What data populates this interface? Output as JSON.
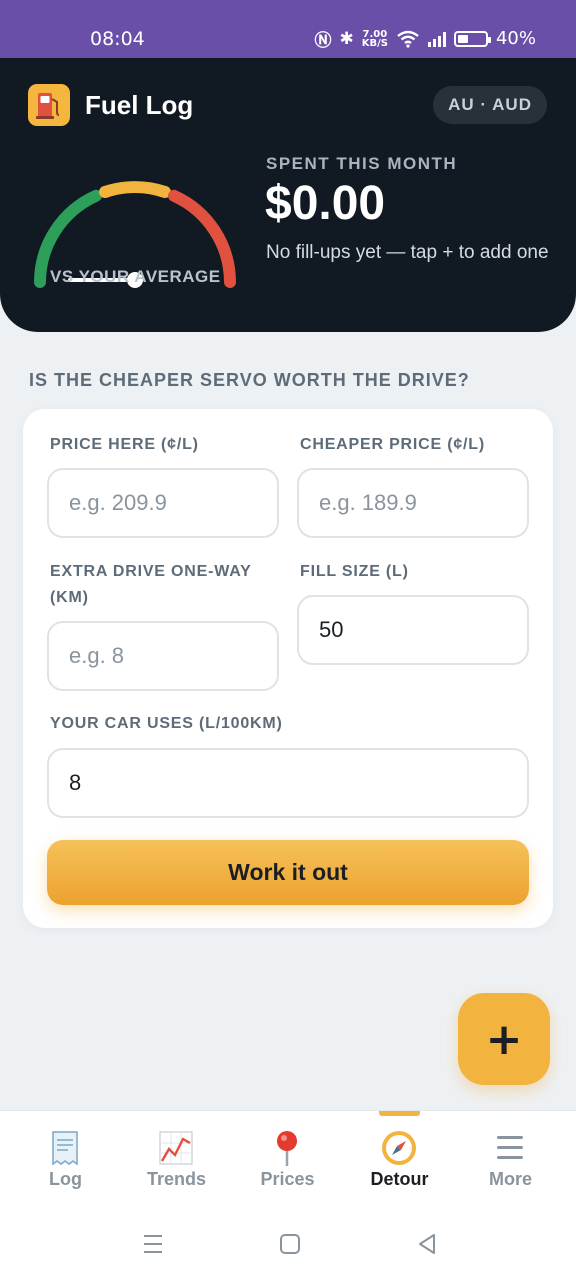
{
  "status_bar": {
    "time": "08:04",
    "net_speed_value": "7.00",
    "net_speed_unit": "KB/S",
    "battery": "40%",
    "battery_level": 0.4
  },
  "header": {
    "app_title": "Fuel Log",
    "region": "AU · AUD",
    "gauge_label": "VS YOUR AVERAGE",
    "spent_label": "SPENT THIS MONTH",
    "spent_value": "$0.00",
    "spent_note": "No fill-ups yet — tap + to add one"
  },
  "calculator": {
    "section_title": "IS THE CHEAPER SERVO WORTH THE DRIVE?",
    "fields": {
      "price_here": {
        "label": "PRICE HERE (¢/L)",
        "value": "",
        "placeholder": "e.g. 209.9"
      },
      "cheaper_price": {
        "label": "CHEAPER PRICE (¢/L)",
        "value": "",
        "placeholder": "e.g. 189.9"
      },
      "extra_drive": {
        "label": "EXTRA DRIVE ONE-WAY (KM)",
        "value": "",
        "placeholder": "e.g. 8"
      },
      "fill_size": {
        "label": "FILL SIZE (L)",
        "value": "50",
        "placeholder": ""
      },
      "car_uses": {
        "label": "YOUR CAR USES (L/100KM)",
        "value": "8",
        "placeholder": ""
      }
    },
    "button_label": "Work it out"
  },
  "fab": {
    "label": "+"
  },
  "bottom_nav": {
    "items": [
      {
        "label": "Log",
        "icon": "receipt-icon"
      },
      {
        "label": "Trends",
        "icon": "chart-icon"
      },
      {
        "label": "Prices",
        "icon": "pin-icon"
      },
      {
        "label": "Detour",
        "icon": "compass-icon",
        "active": true
      },
      {
        "label": "More",
        "icon": "menu-icon"
      }
    ]
  },
  "colors": {
    "status_bar": "#6a4fa8",
    "header_bg": "#111a22",
    "accent": "#f2b43f",
    "gauge_green": "#2e9e5b",
    "gauge_yellow": "#f2b43f",
    "gauge_red": "#e0523f"
  }
}
